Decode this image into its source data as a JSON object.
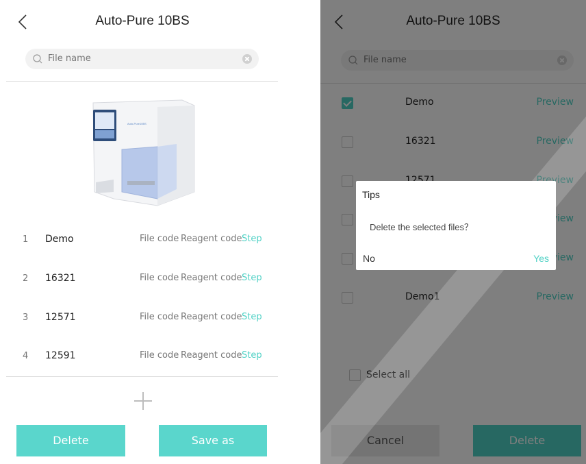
{
  "left_screen": {
    "title": "Auto-Pure 10BS",
    "search": {
      "placeholder": "File name"
    },
    "device_label": "Auto-Pure10BS",
    "files": [
      {
        "index": "1",
        "name": "Demo",
        "file_code": "File code",
        "reagent_code": "Reagent code",
        "step": "Step"
      },
      {
        "index": "2",
        "name": "16321",
        "file_code": "File code",
        "reagent_code": "Reagent code",
        "step": "Step"
      },
      {
        "index": "3",
        "name": "12571",
        "file_code": "File code",
        "reagent_code": "Reagent code",
        "step": "Step"
      },
      {
        "index": "4",
        "name": "12591",
        "file_code": "File code",
        "reagent_code": "Reagent code",
        "step": "Step"
      }
    ],
    "buttons": {
      "delete": "Delete",
      "save_as": "Save as"
    }
  },
  "right_screen": {
    "title": "Auto-Pure 10BS",
    "search": {
      "placeholder": "File name"
    },
    "files": [
      {
        "name": "Demo",
        "checked": true,
        "preview": "Preview"
      },
      {
        "name": "16321",
        "checked": false,
        "preview": "Preview"
      },
      {
        "name": "12571",
        "checked": false,
        "preview": "Preview"
      },
      {
        "name": "",
        "checked": false,
        "preview": "Preview"
      },
      {
        "name": "",
        "checked": false,
        "preview": "Preview"
      },
      {
        "name": "Demo1",
        "checked": false,
        "preview": "Preview"
      }
    ],
    "select_all": "Select all",
    "buttons": {
      "cancel": "Cancel",
      "delete": "Delete"
    },
    "dialog": {
      "title": "Tips",
      "message": "Delete the selected files？",
      "no": "No",
      "yes": "Yes"
    }
  },
  "colors": {
    "accent": "#4fd1c5",
    "button": "#5ad6cc",
    "overlay": "rgba(0,0,0,0.5)"
  },
  "icons": [
    "back-icon",
    "search-icon",
    "clear-icon",
    "add-icon",
    "check-icon"
  ]
}
